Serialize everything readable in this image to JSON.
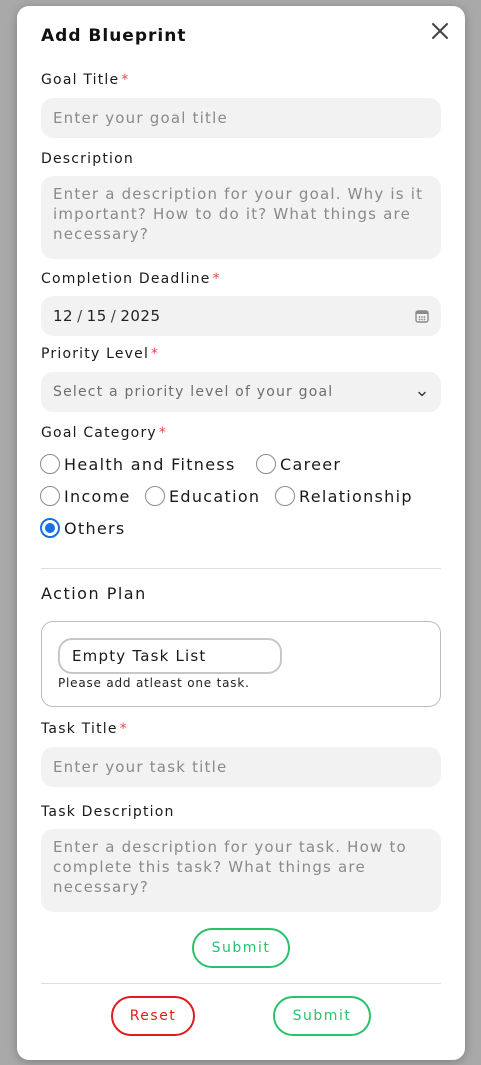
{
  "modal": {
    "title": "Add Blueprint",
    "close_icon": "close-icon"
  },
  "goal_title": {
    "label": "Goal Title",
    "required_mark": "*",
    "placeholder": "Enter your goal title"
  },
  "description": {
    "label": "Description",
    "placeholder": "Enter a description for your goal. Why is it important? How to do it? What things are necessary?"
  },
  "deadline": {
    "label": "Completion Deadline",
    "required_mark": "*",
    "month": "12",
    "day": "15",
    "year": "2025",
    "separator": "/",
    "icon": "calendar-icon"
  },
  "priority": {
    "label": "Priority Level",
    "required_mark": "*",
    "selected": "Select a priority level of your goal",
    "icon": "chevron-down-icon"
  },
  "category": {
    "label": "Goal Category",
    "required_mark": "*",
    "options": [
      {
        "label": "Health and Fitness",
        "checked": false
      },
      {
        "label": "Career",
        "checked": false
      },
      {
        "label": "Income",
        "checked": false
      },
      {
        "label": "Education",
        "checked": false
      },
      {
        "label": "Relationship",
        "checked": false
      },
      {
        "label": "Others",
        "checked": true
      }
    ]
  },
  "action_plan": {
    "title": "Action Plan",
    "empty_label": "Empty Task List",
    "empty_note": "Please add atleast one task."
  },
  "task_title": {
    "label": "Task Title",
    "required_mark": "*",
    "placeholder": "Enter your task title"
  },
  "task_description": {
    "label": "Task Description",
    "placeholder": "Enter a description for your task. How to complete this task? What things are necessary?"
  },
  "buttons": {
    "task_submit": "Submit",
    "reset": "Reset",
    "submit": "Submit"
  },
  "colors": {
    "required": "#e5484d",
    "radio_checked": "#1a6fe6",
    "submit": "#27c26a",
    "reset": "#e01b1b"
  }
}
